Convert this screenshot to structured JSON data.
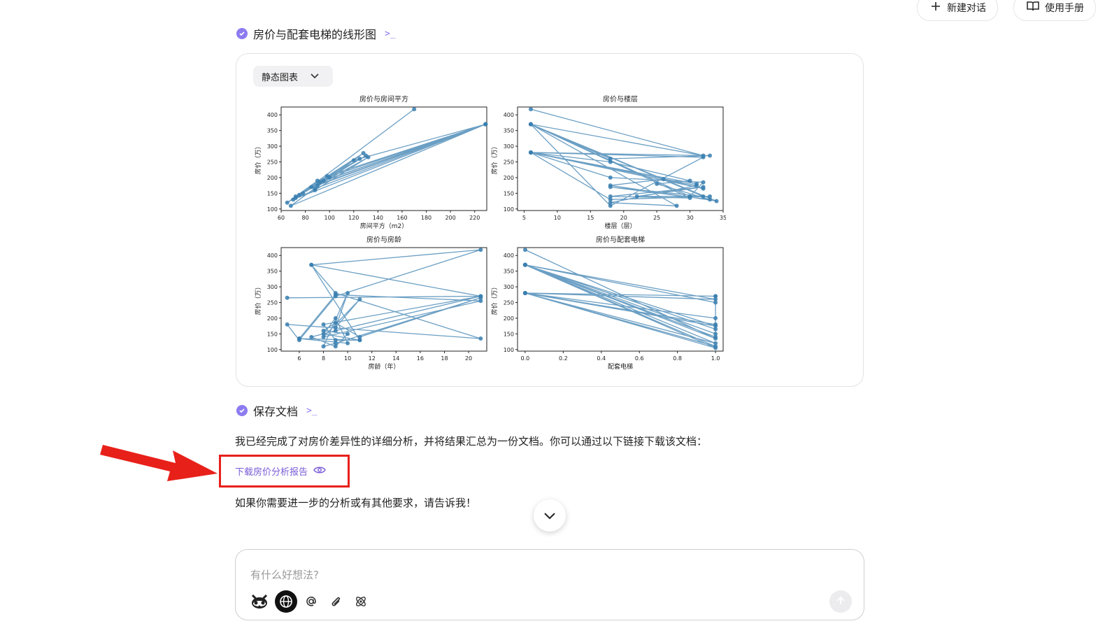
{
  "header": {
    "new_chat_label": "新建对话",
    "manual_label": "使用手册"
  },
  "steps": [
    {
      "label": "房价与配套电梯的线形图",
      "term": ">_"
    },
    {
      "label": "保存文档",
      "term": ">_"
    }
  ],
  "chart_card": {
    "view_mode": "静态图表"
  },
  "chart_data": [
    {
      "type": "line",
      "title": "房价与房间平方",
      "xlabel": "房间平方（m2）",
      "ylabel": "房价（万）",
      "xlim": [
        60,
        230
      ],
      "ylim": [
        95,
        425
      ],
      "xticks": [
        60,
        80,
        100,
        120,
        140,
        160,
        180,
        200,
        220
      ],
      "yticks": [
        100,
        150,
        200,
        250,
        300,
        350,
        400
      ],
      "series": [
        {
          "x": [
            170,
            70,
            229,
            88,
            128,
            72,
            98,
            229,
            90,
            65,
            130,
            100,
            68,
            229,
            120,
            75,
            92,
            229,
            85,
            125,
            78,
            95,
            229,
            90,
            132,
            88,
            72
          ],
          "y": [
            418,
            130,
            370,
            165,
            278,
            140,
            205,
            370,
            190,
            120,
            270,
            200,
            110,
            370,
            255,
            145,
            185,
            370,
            170,
            260,
            150,
            190,
            370,
            175,
            265,
            160,
            135
          ]
        }
      ],
      "color": "#3a7fb0"
    },
    {
      "type": "line",
      "title": "房价与楼层",
      "xlabel": "楼层（层）",
      "ylabel": "房价（万）",
      "xlim": [
        4,
        35
      ],
      "ylim": [
        95,
        425
      ],
      "xticks": [
        5,
        10,
        15,
        20,
        25,
        30,
        35
      ],
      "yticks": [
        100,
        150,
        200,
        250,
        300,
        350,
        400
      ],
      "series": [
        {
          "x": [
            6,
            32,
            6,
            18,
            32,
            6,
            33,
            18,
            6,
            30,
            32,
            18,
            6,
            31,
            18,
            28,
            6,
            32,
            18,
            33,
            25,
            30,
            18,
            6,
            32,
            26,
            18,
            34,
            6,
            30,
            18,
            32,
            22,
            33,
            18,
            6,
            31
          ],
          "y": [
            418,
            270,
            370,
            110,
            265,
            280,
            270,
            260,
            370,
            140,
            185,
            200,
            280,
            175,
            120,
            110,
            370,
            140,
            170,
            130,
            180,
            190,
            250,
            280,
            165,
            195,
            175,
            125,
            370,
            135,
            140,
            170,
            140,
            140,
            130,
            280,
            180
          ]
        }
      ],
      "color": "#3a7fb0"
    },
    {
      "type": "line",
      "title": "房价与房龄",
      "xlabel": "房龄（年）",
      "ylabel": "房价（万）",
      "xlim": [
        4.5,
        21.5
      ],
      "ylim": [
        95,
        425
      ],
      "xticks": [
        6,
        8,
        10,
        12,
        14,
        16,
        18,
        20
      ],
      "yticks": [
        100,
        150,
        200,
        250,
        300,
        350,
        400
      ],
      "series": [
        {
          "x": [
            5,
            21,
            7,
            9,
            21,
            5,
            6,
            9,
            21,
            7,
            11,
            8,
            9,
            10,
            6,
            9,
            21,
            8,
            11,
            9,
            10,
            8,
            9,
            21,
            11,
            9,
            8,
            10,
            9,
            7,
            9,
            21,
            8,
            9,
            11,
            6
          ],
          "y": [
            265,
            270,
            370,
            280,
            135,
            180,
            130,
            270,
            418,
            370,
            130,
            150,
            200,
            120,
            135,
            275,
            255,
            140,
            260,
            170,
            280,
            110,
            120,
            265,
            140,
            185,
            160,
            150,
            110,
            140,
            160,
            270,
            180,
            130,
            130,
            135
          ]
        }
      ],
      "color": "#3a7fb0"
    },
    {
      "type": "line",
      "title": "房价与配套电梯",
      "xlabel": "配套电梯",
      "ylabel": "房价（万）",
      "xlim": [
        -0.04,
        1.04
      ],
      "ylim": [
        95,
        425
      ],
      "xticks": [
        0.0,
        0.2,
        0.4,
        0.6,
        0.8,
        1.0
      ],
      "yticks": [
        100,
        150,
        200,
        250,
        300,
        350,
        400
      ],
      "series": [
        {
          "x": [
            0,
            1,
            0,
            1,
            0,
            1,
            0,
            1,
            0,
            1,
            1,
            0,
            1,
            0,
            1,
            1,
            0,
            1,
            0,
            1,
            1,
            0,
            1,
            1
          ],
          "y": [
            418,
            135,
            370,
            260,
            280,
            110,
            370,
            175,
            280,
            270,
            150,
            370,
            120,
            280,
            200,
            165,
            370,
            105,
            280,
            180,
            250,
            370,
            140,
            270
          ]
        }
      ],
      "color": "#3a7fb0"
    }
  ],
  "message": {
    "done_text": "我已经完成了对房价差异性的详细分析，并将结果汇总为一份文档。你可以通过以下链接下载该文档：",
    "download_link": "下载房价分析报告",
    "followup_text": "如果你需要进一步的分析或有其他要求，请告诉我！"
  },
  "composer": {
    "placeholder": "有什么好想法?"
  },
  "colors": {
    "accent": "#8b7cf0",
    "annotation": "#e8201a",
    "line": "#3a7fb0"
  }
}
